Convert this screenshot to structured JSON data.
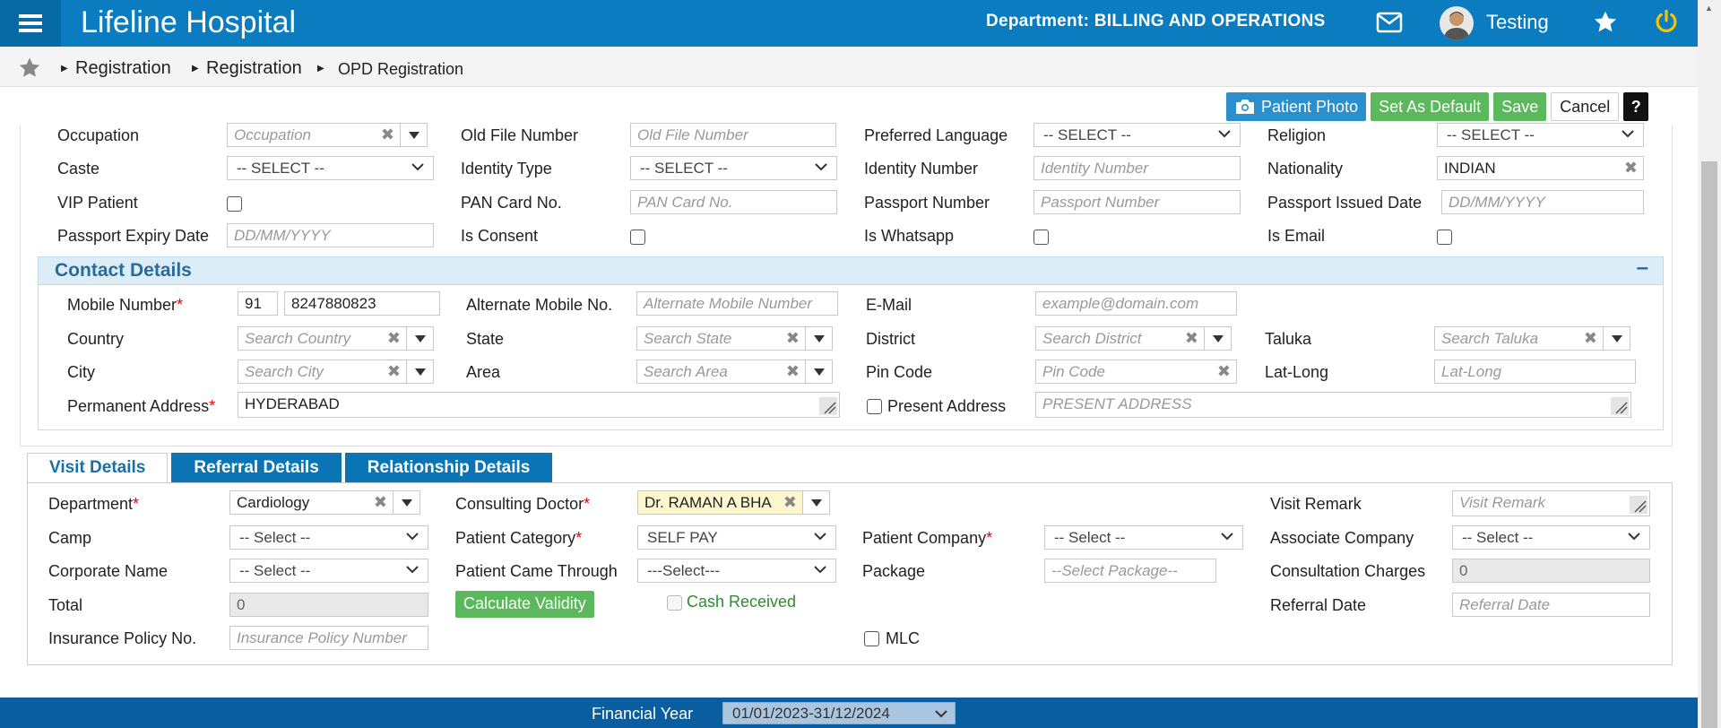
{
  "header": {
    "app_title": "Lifeline Hospital",
    "department": "Department: BILLING AND OPERATIONS",
    "username": "Testing",
    "brand_color": "#0a7cbf",
    "icons": [
      "menu-icon",
      "mail-icon",
      "avatar",
      "star-icon",
      "power-icon"
    ]
  },
  "breadcrumb": {
    "items": [
      "Registration",
      "Registration",
      "OPD Registration"
    ]
  },
  "actions": {
    "patient_photo": "Patient Photo",
    "set_default": "Set As Default",
    "save": "Save",
    "cancel": "Cancel",
    "help": "?"
  },
  "personal": {
    "occupation": {
      "label": "Occupation",
      "placeholder": "Occupation"
    },
    "old_file": {
      "label": "Old File Number",
      "placeholder": "Old File Number"
    },
    "preferred_language": {
      "label": "Preferred Language",
      "value": "-- SELECT --"
    },
    "religion": {
      "label": "Religion",
      "value": "-- SELECT --"
    },
    "caste": {
      "label": "Caste",
      "value": "-- SELECT --"
    },
    "identity_type": {
      "label": "Identity Type",
      "value": "-- SELECT --"
    },
    "identity_number": {
      "label": "Identity Number",
      "placeholder": "Identity Number"
    },
    "nationality": {
      "label": "Nationality",
      "value": "INDIAN"
    },
    "vip": {
      "label": "VIP Patient"
    },
    "pan": {
      "label": "PAN Card No.",
      "placeholder": "PAN Card No."
    },
    "passport_number": {
      "label": "Passport Number",
      "placeholder": "Passport Number"
    },
    "passport_issued": {
      "label": "Passport Issued Date",
      "placeholder": "DD/MM/YYYY"
    },
    "passport_expiry": {
      "label": "Passport Expiry Date",
      "placeholder": "DD/MM/YYYY"
    },
    "is_consent": {
      "label": "Is Consent"
    },
    "is_whatsapp": {
      "label": "Is Whatsapp"
    },
    "is_email": {
      "label": "Is Email"
    }
  },
  "contact": {
    "title": "Contact Details",
    "collapse": "–",
    "mobile": {
      "label": "Mobile Number",
      "code": "91",
      "value": "8247880823"
    },
    "alt_mobile": {
      "label": "Alternate Mobile No.",
      "placeholder": "Alternate Mobile Number"
    },
    "email": {
      "label": "E-Mail",
      "placeholder": "example@domain.com"
    },
    "country": {
      "label": "Country",
      "placeholder": "Search Country"
    },
    "state": {
      "label": "State",
      "placeholder": "Search State"
    },
    "district": {
      "label": "District",
      "placeholder": "Search District"
    },
    "taluka": {
      "label": "Taluka",
      "placeholder": "Search Taluka"
    },
    "city": {
      "label": "City",
      "placeholder": "Search City"
    },
    "area": {
      "label": "Area",
      "placeholder": "Search Area"
    },
    "pin": {
      "label": "Pin Code",
      "placeholder": "Pin Code"
    },
    "latlong": {
      "label": "Lat-Long",
      "placeholder": "Lat-Long"
    },
    "permanent_address": {
      "label": "Permanent Address",
      "value": "HYDERABAD"
    },
    "present_address": {
      "label": "Present Address",
      "placeholder": "PRESENT ADDRESS"
    }
  },
  "tabs": [
    "Visit Details",
    "Referral Details",
    "Relationship Details"
  ],
  "visit": {
    "department": {
      "label": "Department",
      "value": "Cardiology"
    },
    "consulting_doctor": {
      "label": "Consulting Doctor",
      "value": "Dr. RAMAN A BHA"
    },
    "visit_remark": {
      "label": "Visit Remark",
      "placeholder": "Visit Remark"
    },
    "camp": {
      "label": "Camp",
      "value": "-- Select --"
    },
    "patient_category": {
      "label": "Patient Category",
      "value": "SELF PAY"
    },
    "patient_company": {
      "label": "Patient Company",
      "value": "-- Select --"
    },
    "associate_company": {
      "label": "Associate Company",
      "value": "-- Select --"
    },
    "corporate_name": {
      "label": "Corporate Name",
      "value": "-- Select --"
    },
    "came_through": {
      "label": "Patient Came Through",
      "value": "---Select---"
    },
    "package": {
      "label": "Package",
      "placeholder": "--Select Package--"
    },
    "consultation_charges": {
      "label": "Consultation Charges",
      "value": "0"
    },
    "total": {
      "label": "Total",
      "value": "0"
    },
    "calculate": "Calculate Validity",
    "cash_received": "Cash Received",
    "referral_date": {
      "label": "Referral Date",
      "placeholder": "Referral Date"
    },
    "insurance": {
      "label": "Insurance Policy No.",
      "placeholder": "Insurance Policy Number"
    },
    "mlc": "MLC"
  },
  "footer": {
    "financial_year_label": "Financial Year",
    "financial_year": "01/01/2023-31/12/2024"
  }
}
